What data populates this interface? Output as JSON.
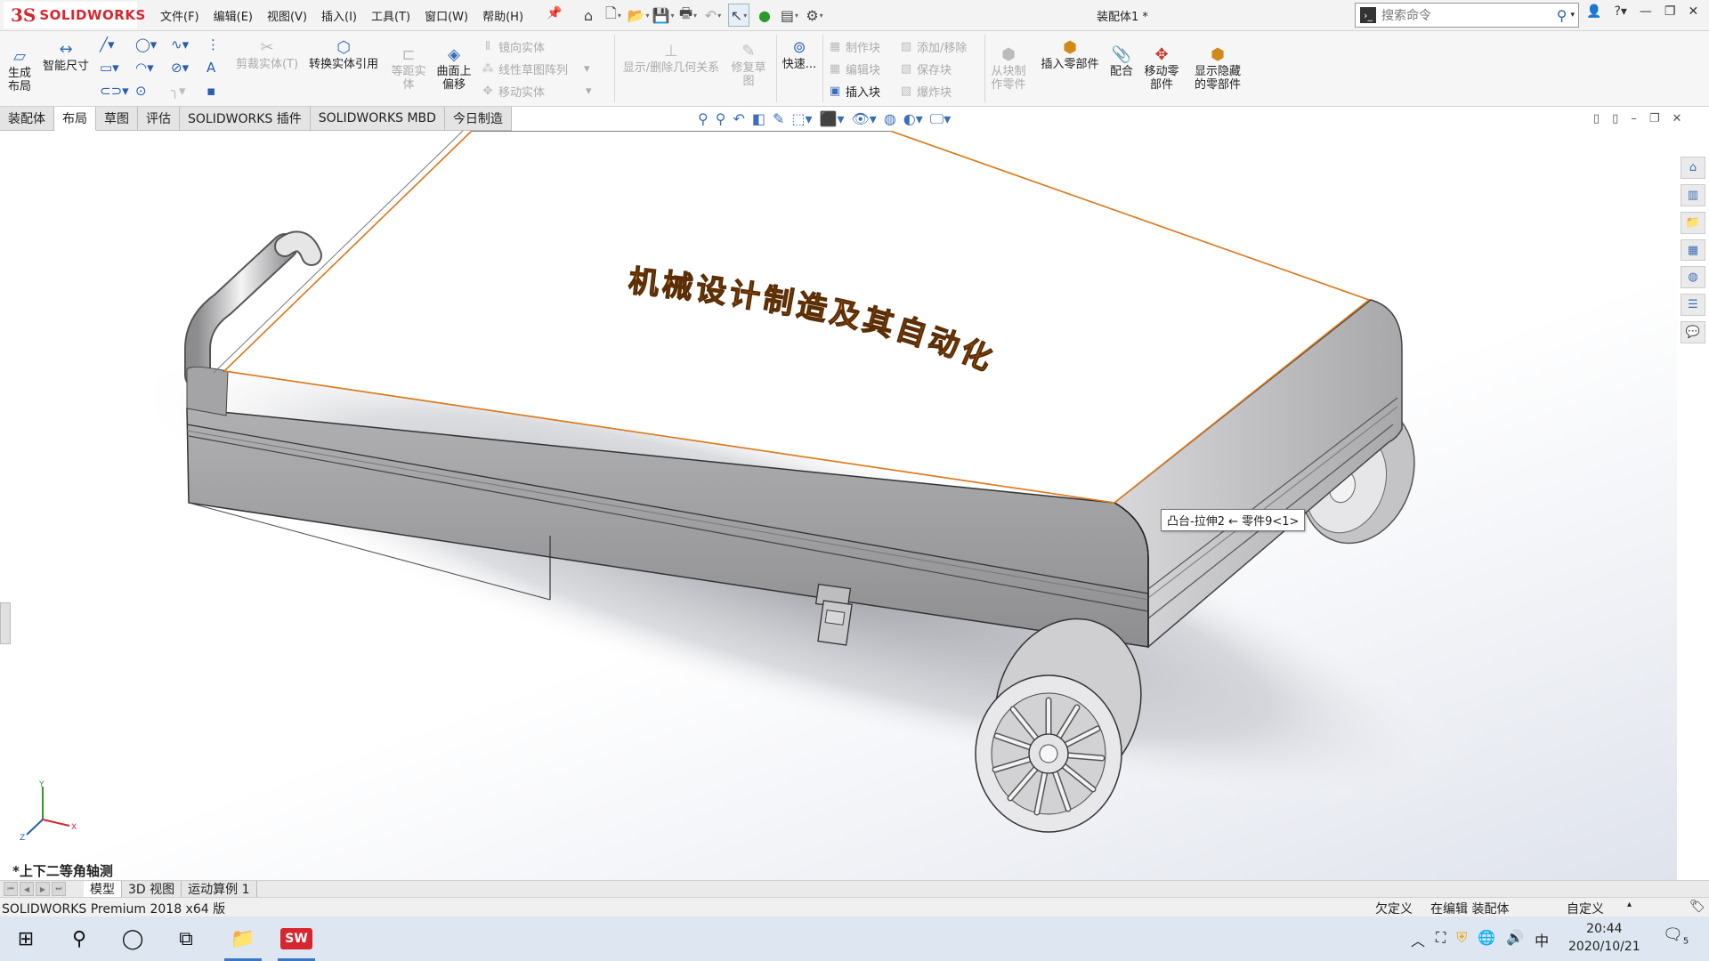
{
  "app": {
    "logo_text": "SOLIDWORKS",
    "menus": [
      "文件(F)",
      "编辑(E)",
      "视图(V)",
      "插入(I)",
      "工具(T)",
      "窗口(W)",
      "帮助(H)"
    ],
    "document_title": "装配体1 *",
    "search_placeholder": "搜索命令"
  },
  "ribbon": {
    "make_layout": "生成\n布局",
    "smart_dimension": "智能尺寸",
    "trim_entities": "剪裁实体(T)",
    "convert_entities": "转换实体引用",
    "offset_entities": "等距实\n体",
    "offset_on_surface": "曲面上\n偏移",
    "mirror_entities": "镜向实体",
    "linear_pattern": "线性草图阵列",
    "move_entities": "移动实体",
    "display_delete_relations": "显示/删除几何关系",
    "repair_sketch": "修复草\n图",
    "quick_snaps": "快速...",
    "make_block": "制作块",
    "edit_block": "编辑块",
    "insert_block": "插入块",
    "add_remove": "添加/移除",
    "save_block": "保存块",
    "explode_block": "爆炸块",
    "make_part_from_block": "从块制\n作零件",
    "insert_components": "插入零部件",
    "mate": "配合",
    "move_component": "移动零\n部件",
    "show_hidden": "显示隐藏\n的零部件"
  },
  "tabs": [
    "装配体",
    "布局",
    "草图",
    "评估",
    "SOLIDWORKS 插件",
    "SOLIDWORKS MBD",
    "今日制造"
  ],
  "active_tab": "布局",
  "viewport": {
    "lid_text": "机械设计制造及其自动化",
    "tooltip": "凸台-拉伸2 ← 零件9<1>",
    "view_name": "*上下二等角轴测"
  },
  "bottom_tabs": [
    "模型",
    "3D 视图",
    "运动算例 1"
  ],
  "status": {
    "product": "SOLIDWORKS Premium 2018 x64 版",
    "under_defined": "欠定义",
    "editing": "在编辑 装配体",
    "custom": "自定义"
  },
  "taskbar": {
    "ime": "中",
    "time": "20:44",
    "date": "2020/10/21",
    "notification_count": "5"
  },
  "colors": {
    "brand_red": "#d7262e",
    "edge_orange": "#e07b1a",
    "text_orange": "#d9781c",
    "body_gray": "#a3a3a6"
  }
}
